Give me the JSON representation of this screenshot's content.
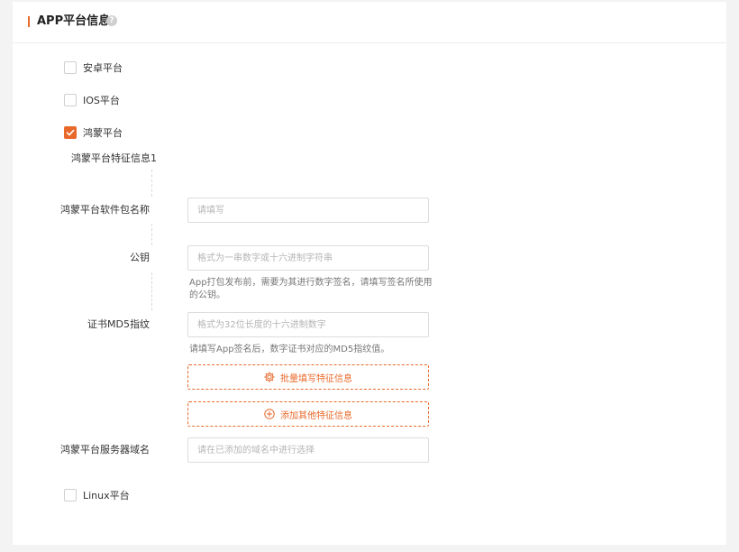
{
  "header": {
    "title": "APP平台信息",
    "help_icon": "question-circle-icon",
    "help_glyph": "?"
  },
  "platforms": {
    "android": {
      "label": "安卓平台",
      "checked": false
    },
    "ios": {
      "label": "IOS平台",
      "checked": false
    },
    "harmony": {
      "label": "鸿蒙平台",
      "checked": true
    },
    "linux": {
      "label": "Linux平台",
      "checked": false
    }
  },
  "harmony_section": {
    "title": "鸿蒙平台特征信息1",
    "package_name": {
      "label": "鸿蒙平台软件包名称",
      "placeholder": "请填写",
      "value": ""
    },
    "public_key": {
      "label": "公钥",
      "placeholder": "格式为一串数字或十六进制字符串",
      "value": "",
      "hint": "App打包发布前，需要为其进行数字签名，请填写签名所使用的公钥。"
    },
    "cert_md5": {
      "label": "证书MD5指纹",
      "placeholder": "格式为32位长度的十六进制数字",
      "value": "",
      "hint": "请填写App签名后，数字证书对应的MD5指纹值。"
    },
    "batch_fill_button": {
      "label": "批量填写特征信息",
      "icon": "gear-icon"
    },
    "add_other_button": {
      "label": "添加其他特征信息",
      "icon": "plus-circle-icon"
    },
    "server_domain": {
      "label": "鸿蒙平台服务器域名",
      "placeholder": "请在已添加的域名中进行选择",
      "value": ""
    }
  },
  "colors": {
    "accent": "#e8692a",
    "border": "#dcdcdc",
    "background": "#f3f3f4"
  }
}
